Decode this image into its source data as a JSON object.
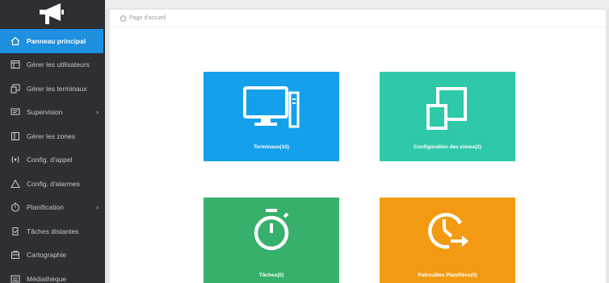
{
  "sidebar": {
    "items": [
      {
        "label": "Panneau principal",
        "icon": "home-icon"
      },
      {
        "label": "Gérer les utilisateurs",
        "icon": "users-icon"
      },
      {
        "label": "Gérer les terminaux",
        "icon": "terminals-icon"
      },
      {
        "label": "Supervision",
        "icon": "monitor-icon"
      },
      {
        "label": "Gérer les zones",
        "icon": "zones-icon"
      },
      {
        "label": "Config. d'appel",
        "icon": "call-icon"
      },
      {
        "label": "Config. d'alarmes",
        "icon": "alarm-icon"
      },
      {
        "label": "Planification",
        "icon": "clock-icon"
      },
      {
        "label": "Tâches distantes",
        "icon": "tasks-icon"
      },
      {
        "label": "Cartographie",
        "icon": "map-icon"
      },
      {
        "label": "Médiathèque",
        "icon": "media-icon"
      }
    ]
  },
  "breadcrumb": {
    "label": "Page d'accueil",
    "icon": "home-outline-icon"
  },
  "tiles": [
    {
      "label": "Terminaux(10)",
      "icon": "desktop-computer-icon",
      "color": "#14a0ea"
    },
    {
      "label": "Configuration des zones(2)",
      "icon": "zones-squares-icon",
      "color": "#2ec9a8"
    },
    {
      "label": "Tâches(0)",
      "icon": "stopwatch-icon",
      "color": "#36b06a"
    },
    {
      "label": "Patrouilles Planifiées(0)",
      "icon": "scheduled-clock-icon",
      "color": "#f29b12"
    }
  ],
  "colors": {
    "sidebar_bg": "#2d2f33",
    "active": "#1f8fe0"
  }
}
